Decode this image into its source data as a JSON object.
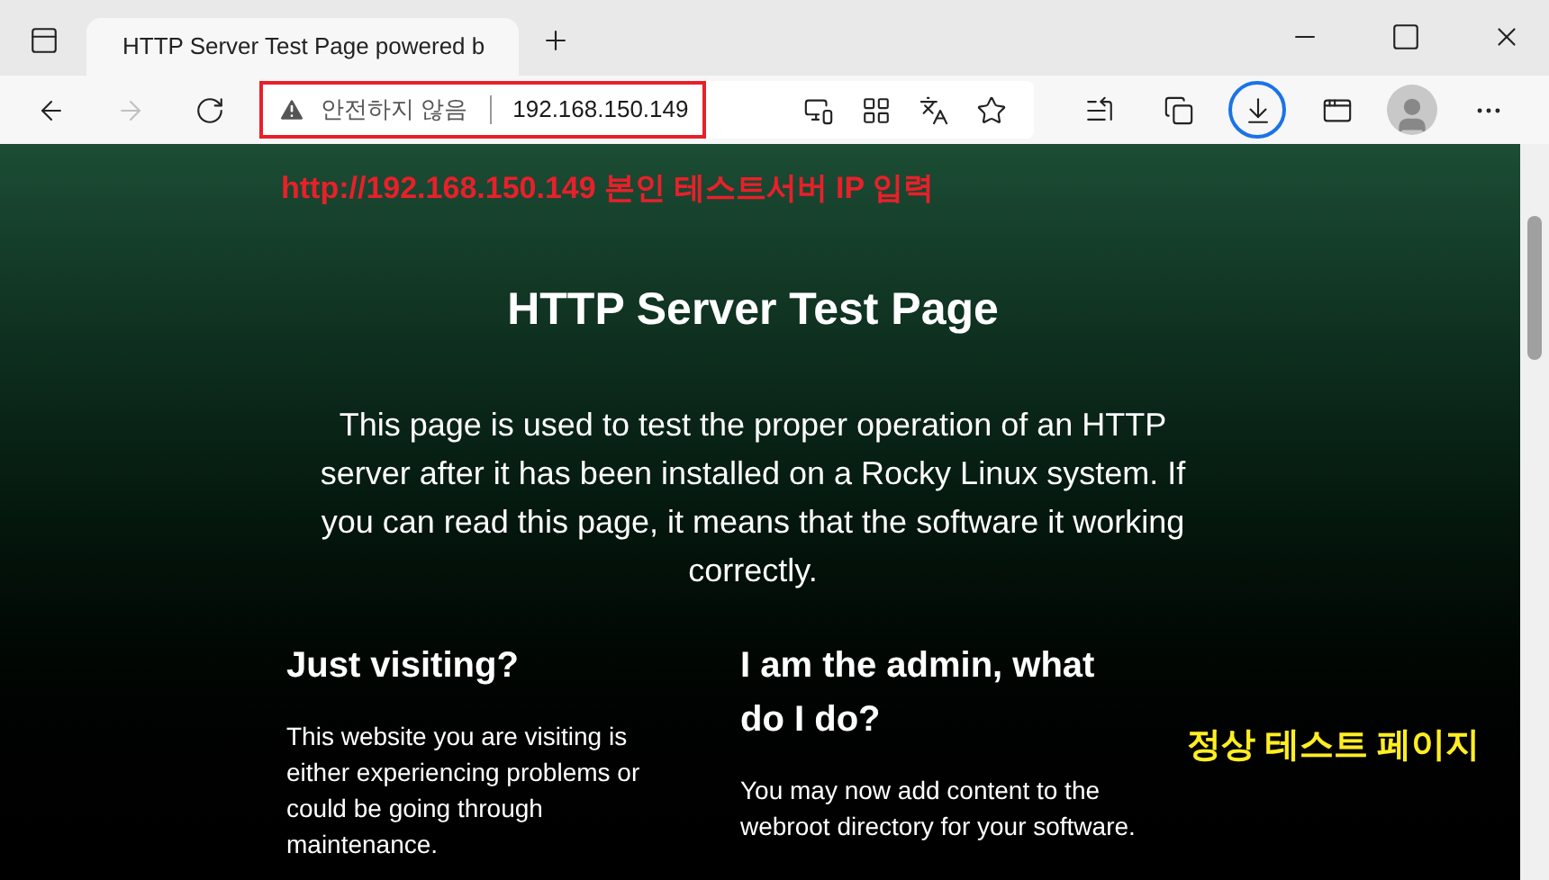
{
  "tab": {
    "title": "HTTP Server Test Page powered b",
    "selected": true
  },
  "address_bar": {
    "security": "안전하지 않음",
    "url": "192.168.150.149"
  },
  "page": {
    "title": "HTTP Server Test Page",
    "intro": "This page is used to test the proper operation of an HTTP server after it has been installed on a Rocky Linux system. If you can read this page, it means that the software it working correctly.",
    "columns": [
      {
        "heading": "Just visiting?",
        "text": "This website you are visiting is either experiencing problems or could be going through maintenance."
      },
      {
        "heading": "I am the admin, what do I do?",
        "text": "You may now add content to the webroot directory for your software."
      }
    ]
  },
  "annotations": [
    {
      "text": "http://192.168.150.149 본인 테스트서버 IP 입력",
      "color": "#e8202a"
    },
    {
      "text": "정상 테스트 페이지",
      "color": "#ffee22"
    }
  ]
}
